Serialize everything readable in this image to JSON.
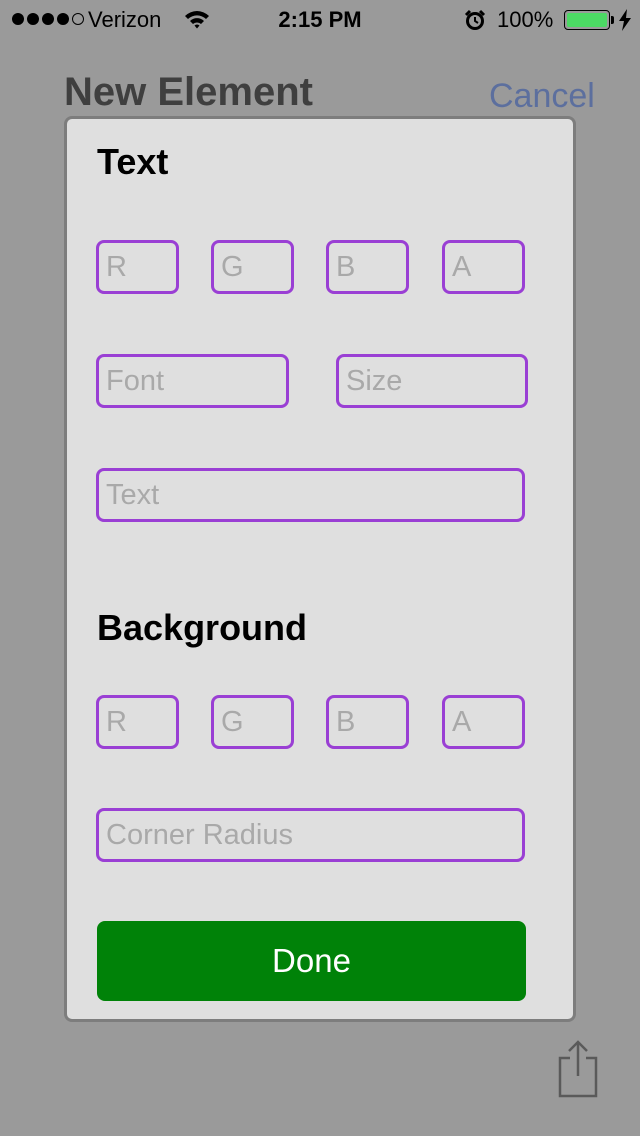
{
  "status_bar": {
    "carrier": "Verizon",
    "time": "2:15 PM",
    "battery_percent": "100%",
    "signal_bars_filled": 4,
    "signal_bars_total": 5,
    "battery_color": "#4cd964"
  },
  "nav": {
    "title": "New Element",
    "cancel_label": "Cancel"
  },
  "text_section": {
    "title": "Text",
    "r_placeholder": "R",
    "g_placeholder": "G",
    "b_placeholder": "B",
    "a_placeholder": "A",
    "font_placeholder": "Font",
    "size_placeholder": "Size",
    "text_placeholder": "Text"
  },
  "background_section": {
    "title": "Background",
    "r_placeholder": "R",
    "g_placeholder": "G",
    "b_placeholder": "B",
    "a_placeholder": "A",
    "corner_radius_placeholder": "Corner Radius"
  },
  "done_label": "Done",
  "colors": {
    "field_border": "#9a3fd4",
    "done_button": "#008208",
    "cancel_link": "#5c6f9e"
  },
  "icons": {
    "wifi": "wifi-icon",
    "alarm": "alarm-clock-icon",
    "charging": "lightning-bolt-icon",
    "share": "share-icon"
  }
}
